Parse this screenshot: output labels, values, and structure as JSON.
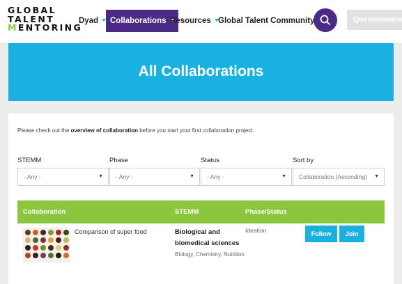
{
  "header": {
    "logo": {
      "line1": "GLOBAL",
      "line2": "TALENT",
      "line3_first": "M",
      "line3_rest": "ENTORING"
    },
    "nav": [
      {
        "label": "Dyad"
      },
      {
        "label": "Collaborations"
      },
      {
        "label": "Resources"
      },
      {
        "label": "Global Talent Community"
      }
    ],
    "questionnaire_label": "Questionnaire"
  },
  "banner": {
    "title": "All Collaborations"
  },
  "intro": {
    "before": "Please check out the ",
    "link": "overview of collaboration",
    "after": " before you start your first collaboration project."
  },
  "filters": [
    {
      "label": "STEMM",
      "value": "- Any -"
    },
    {
      "label": "Phase",
      "value": "- Any -"
    },
    {
      "label": "Status",
      "value": "- Any -"
    },
    {
      "label": "Sort by",
      "value": "Collaboration (Ascending)"
    }
  ],
  "table": {
    "headers": [
      "Collaboration",
      "STEMM",
      "Phase/Status"
    ],
    "rows": [
      {
        "title": "Comparison of super food",
        "stemm_main": "Biological and biomedical sciences",
        "stemm_sub": "Biology, Chemistry, Nutrition",
        "phase": "Ideation",
        "follow_label": "Follow",
        "join_label": "Join"
      }
    ]
  },
  "colors": {
    "nav_active": "#4a2a85",
    "accent_blue": "#1ab0e0",
    "table_header_green": "#8cc63f"
  },
  "icons": {
    "search": "search-icon",
    "dropdown": "chevron-down-icon"
  }
}
